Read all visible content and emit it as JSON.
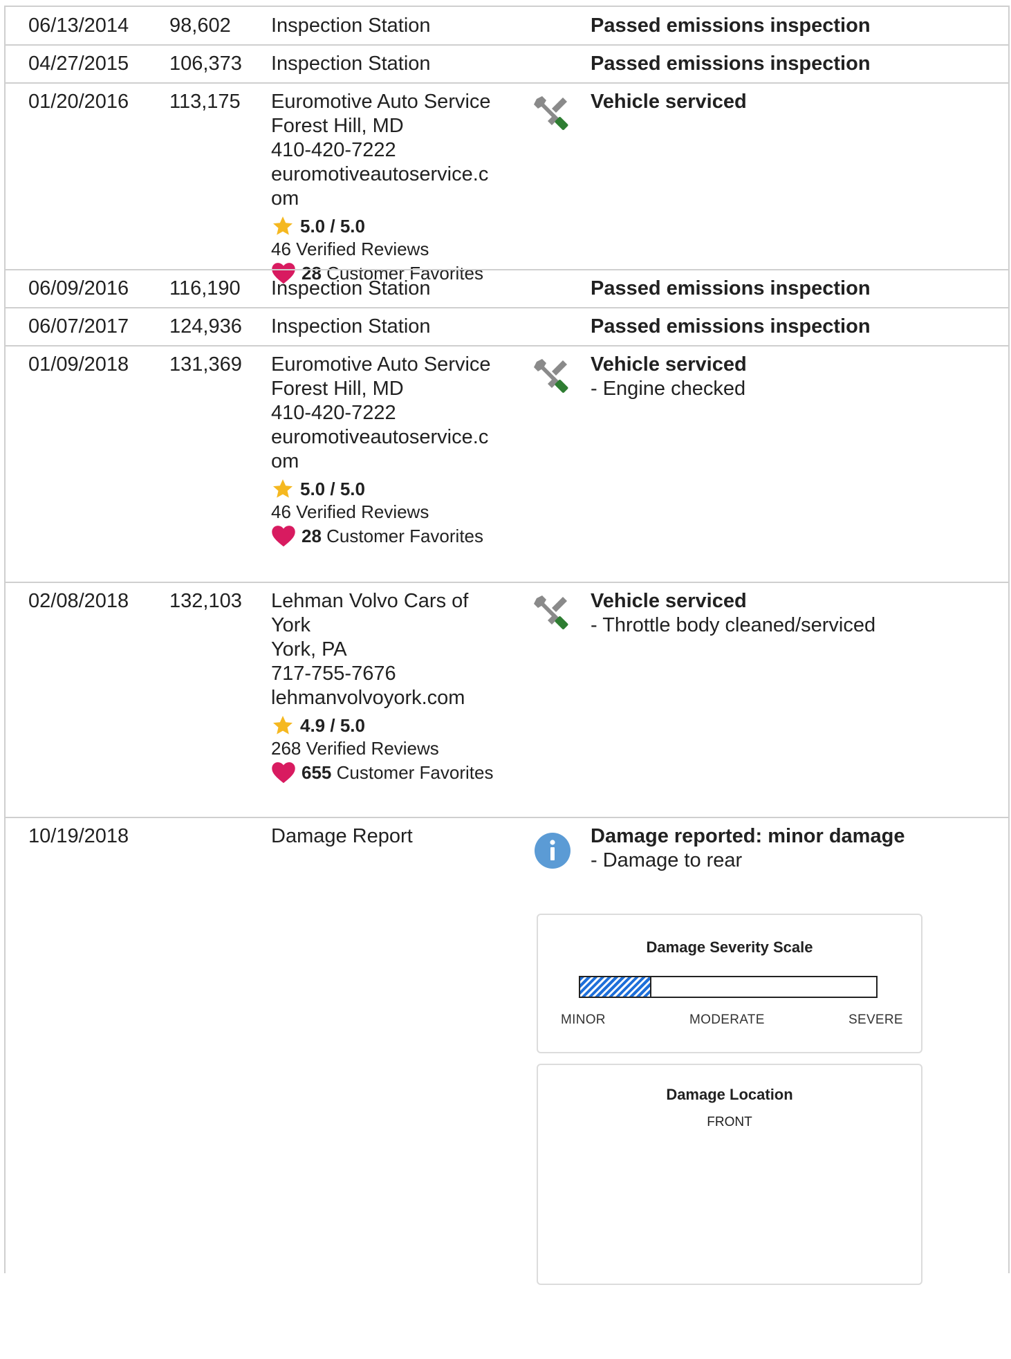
{
  "records": [
    {
      "date": "06/13/2014",
      "odometer": "98,602",
      "source": [
        "Inspection Station"
      ],
      "comment": "Passed emissions inspection"
    },
    {
      "date": "04/27/2015",
      "odometer": "106,373",
      "source": [
        "Inspection Station"
      ],
      "comment": "Passed emissions inspection"
    },
    {
      "date": "01/20/2016",
      "odometer": "113,175",
      "source": [
        "Euromotive Auto Service",
        "Forest Hill, MD",
        "410-420-7222",
        "euromotiveautoservice.c",
        "om"
      ],
      "rating": "5.0 / 5.0",
      "reviews": "46 Verified Reviews",
      "favorites_count": "28",
      "favorites_label": "Customer Favorites",
      "icon": "wrench-screwdriver-icon",
      "comment": "Vehicle serviced"
    },
    {
      "date": "06/09/2016",
      "odometer": "116,190",
      "source": [
        "Inspection Station"
      ],
      "comment": "Passed emissions inspection"
    },
    {
      "date": "06/07/2017",
      "odometer": "124,936",
      "source": [
        "Inspection Station"
      ],
      "comment": "Passed emissions inspection"
    },
    {
      "date": "01/09/2018",
      "odometer": "131,369",
      "source": [
        "Euromotive Auto Service",
        "Forest Hill, MD",
        "410-420-7222",
        "euromotiveautoservice.c",
        "om"
      ],
      "rating": "5.0 / 5.0",
      "reviews": "46 Verified Reviews",
      "favorites_count": "28",
      "favorites_label": "Customer Favorites",
      "icon": "wrench-screwdriver-icon",
      "comment": "Vehicle serviced",
      "detail": "- Engine checked"
    },
    {
      "date": "02/08/2018",
      "odometer": "132,103",
      "source": [
        "Lehman Volvo Cars of",
        "York",
        "York, PA",
        "717-755-7676",
        "lehmanvolvoyork.com"
      ],
      "rating": "4.9 / 5.0",
      "reviews": "268 Verified Reviews",
      "favorites_count": "655",
      "favorites_label": "Customer Favorites",
      "icon": "wrench-screwdriver-icon",
      "comment": "Vehicle serviced",
      "detail": "- Throttle body cleaned/serviced"
    },
    {
      "date": "10/19/2018",
      "odometer": "",
      "source": [
        "Damage Report"
      ],
      "icon": "info-icon",
      "comment": "Damage reported: minor damage",
      "detail": "- Damage to rear"
    }
  ],
  "damage_scale": {
    "title": "Damage Severity Scale",
    "level_fraction": 0.24,
    "labels": {
      "minor": "MINOR",
      "moderate": "MODERATE",
      "severe": "SEVERE"
    }
  },
  "damage_location": {
    "title": "Damage Location",
    "front_label": "FRONT"
  },
  "colors": {
    "star": "#f5b820",
    "heart": "#d81b60",
    "wrench_gray": "#8a8a8a",
    "screwdriver_green": "#2e7d32",
    "info_blue": "#5b9bd5",
    "scale_fill": "#1e6fd9",
    "border": "#cfcfcf"
  }
}
